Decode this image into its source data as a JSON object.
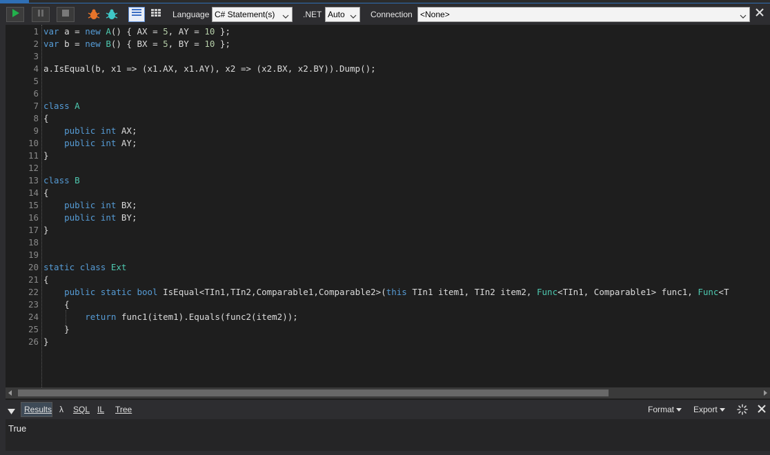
{
  "toolbar": {
    "run_icon": "play-icon",
    "pause_icon": "pause-icon",
    "stop_icon": "stop-icon",
    "debug_icons": [
      "bug-icon-orange",
      "bug-icon-teal"
    ],
    "view_icons": [
      "rich-text-grid-icon",
      "data-grid-icon"
    ],
    "language_label": "Language",
    "language_value": "C# Statement(s)",
    "dotnet_label": ".NET",
    "dotnet_value": "Auto",
    "connection_label": "Connection",
    "connection_value": "<None>"
  },
  "editor": {
    "lines": [
      {
        "n": "1"
      },
      {
        "n": "2"
      },
      {
        "n": "3"
      },
      {
        "n": "4"
      },
      {
        "n": "5"
      },
      {
        "n": "6"
      },
      {
        "n": "7"
      },
      {
        "n": "8"
      },
      {
        "n": "9"
      },
      {
        "n": "10"
      },
      {
        "n": "11"
      },
      {
        "n": "12"
      },
      {
        "n": "13"
      },
      {
        "n": "14"
      },
      {
        "n": "15"
      },
      {
        "n": "16"
      },
      {
        "n": "17"
      },
      {
        "n": "18"
      },
      {
        "n": "19"
      },
      {
        "n": "20"
      },
      {
        "n": "21"
      },
      {
        "n": "22"
      },
      {
        "n": "23"
      },
      {
        "n": "24"
      },
      {
        "n": "25"
      },
      {
        "n": "26"
      }
    ],
    "code": {
      "l1_a": "var",
      "l1_b": " a = ",
      "l1_c": "new",
      "l1_d": " ",
      "l1_e": "A",
      "l1_f": "() { AX = ",
      "l1_g": "5",
      "l1_h": ", AY = ",
      "l1_i": "10",
      "l1_j": " };",
      "l2_a": "var",
      "l2_b": " b = ",
      "l2_c": "new",
      "l2_d": " ",
      "l2_e": "B",
      "l2_f": "() { BX = ",
      "l2_g": "5",
      "l2_h": ", BY = ",
      "l2_i": "10",
      "l2_j": " };",
      "l4": "a.IsEqual(b, x1 => (x1.AX, x1.AY), x2 => (x2.BX, x2.BY)).Dump();",
      "l7_a": "class",
      "l7_b": " ",
      "l7_c": "A",
      "l8": "{",
      "l9_a": "    ",
      "l9_b": "public",
      "l9_c": " ",
      "l9_d": "int",
      "l9_e": " AX;",
      "l10_a": "    ",
      "l10_b": "public",
      "l10_c": " ",
      "l10_d": "int",
      "l10_e": " AY;",
      "l11": "}",
      "l13_a": "class",
      "l13_b": " ",
      "l13_c": "B",
      "l14": "{",
      "l15_a": "    ",
      "l15_b": "public",
      "l15_c": " ",
      "l15_d": "int",
      "l15_e": " BX;",
      "l16_a": "    ",
      "l16_b": "public",
      "l16_c": " ",
      "l16_d": "int",
      "l16_e": " BY;",
      "l17": "}",
      "l20_a": "static",
      "l20_b": " ",
      "l20_c": "class",
      "l20_d": " ",
      "l20_e": "Ext",
      "l21": "{",
      "l22_a": "    ",
      "l22_b": "public",
      "l22_c": " ",
      "l22_d": "static",
      "l22_e": " ",
      "l22_f": "bool",
      "l22_g": " IsEqual<TIn1,TIn2,Comparable1,Comparable2>(",
      "l22_h": "this",
      "l22_i": " TIn1 item1, TIn2 item2, ",
      "l22_j": "Func",
      "l22_k": "<TIn1, Comparable1> func1, ",
      "l22_l": "Func",
      "l22_m": "<T",
      "l23": "    {",
      "l24_a": "        ",
      "l24_b": "return",
      "l24_c": " func1(item1).Equals(func2(item2));",
      "l25": "    }",
      "l26": "}"
    }
  },
  "results": {
    "tabs": [
      "Results",
      "λ",
      "SQL",
      "IL",
      "Tree"
    ],
    "format_label": "Format",
    "export_label": "Export",
    "output": "True"
  },
  "colors": {
    "accent": "#2f6fb5",
    "keyword": "#569cd6",
    "number": "#b5cea8",
    "type": "#4ec9b0"
  }
}
